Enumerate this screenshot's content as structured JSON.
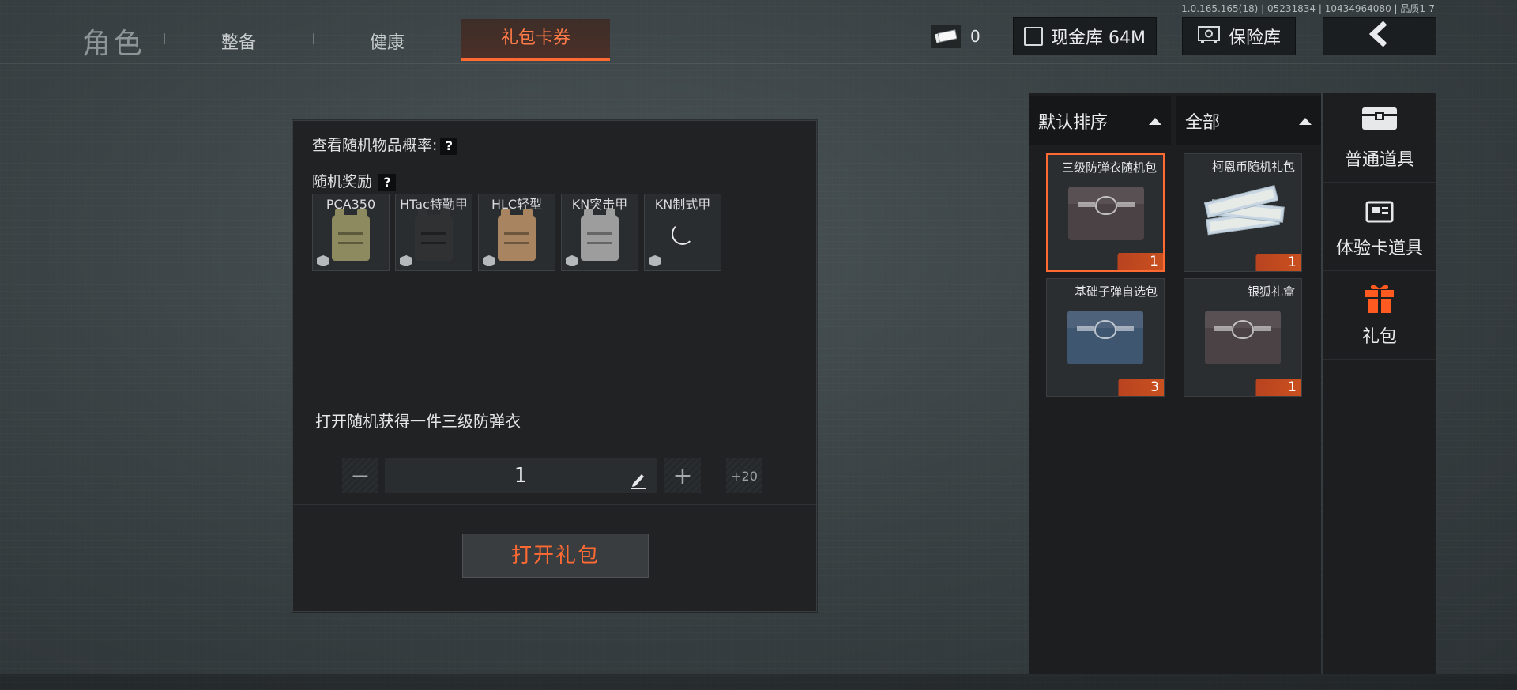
{
  "header": {
    "title": "角色",
    "tabs": [
      {
        "label": "整备"
      },
      {
        "label": "健康"
      },
      {
        "label": "礼包卡券"
      }
    ],
    "version": "1.0.165.165(18) | 05231834 | 10434964080 | 品质1-7",
    "currency_value": "0",
    "cash_label": "现金库 64M",
    "safe_label": "保险库",
    "back_icon": "chevron-left-icon"
  },
  "dialog": {
    "probability_label": "查看随机物品概率:",
    "help": "?",
    "reward_label": "随机奖励",
    "rewards": [
      {
        "name": "PCA350",
        "color": "#8c8a5e"
      },
      {
        "name": "HTac特勤甲",
        "color": "#2f3133"
      },
      {
        "name": "HLC轻型",
        "color": "#a88560"
      },
      {
        "name": "KN突击甲",
        "color": "#9c9d9c"
      },
      {
        "name": "KN制式甲",
        "loading": true
      }
    ],
    "description": "打开随机获得一件三级防弹衣",
    "quantity": "1",
    "minus": "−",
    "plus": "+",
    "plus20": "+20",
    "open_button": "打开礼包"
  },
  "filters": {
    "sort": "默认排序",
    "category": "全部"
  },
  "items": [
    {
      "name": "三级防弹衣随机包",
      "count": "1",
      "selected": true,
      "type": "box",
      "color": "#4a4244"
    },
    {
      "name": "柯恩币随机礼包",
      "count": "1",
      "selected": false,
      "type": "money"
    },
    {
      "name": "基础子弹自选包",
      "count": "3",
      "selected": false,
      "type": "box",
      "color": "#3f5670"
    },
    {
      "name": "银狐礼盒",
      "count": "1",
      "selected": false,
      "type": "box",
      "color": "#4a4244"
    }
  ],
  "categories": [
    {
      "label": "普通道具",
      "icon": "chest-icon"
    },
    {
      "label": "体验卡道具",
      "icon": "card-icon"
    },
    {
      "label": "礼包",
      "icon": "gift-icon",
      "active_color": "#ff5a1f"
    }
  ],
  "colors": {
    "accent": "#ff6a33"
  }
}
